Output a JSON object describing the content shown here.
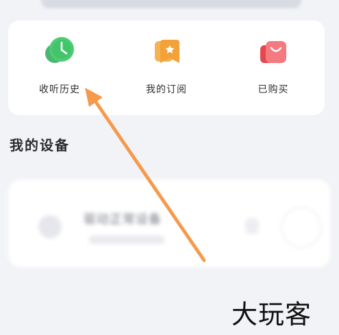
{
  "shortcuts": [
    {
      "label": "收听历史",
      "icon": "clock-icon",
      "color": "#3fbf6a"
    },
    {
      "label": "我的订阅",
      "icon": "subscribe-icon",
      "color": "#f3a23a"
    },
    {
      "label": "已购买",
      "icon": "bag-icon",
      "color": "#f0606a"
    }
  ],
  "devices_section": {
    "title": "我的设备",
    "device_name": "驱动正常设备"
  },
  "annotation": {
    "arrow_color": "#f59a4d"
  },
  "watermark": "大玩客"
}
